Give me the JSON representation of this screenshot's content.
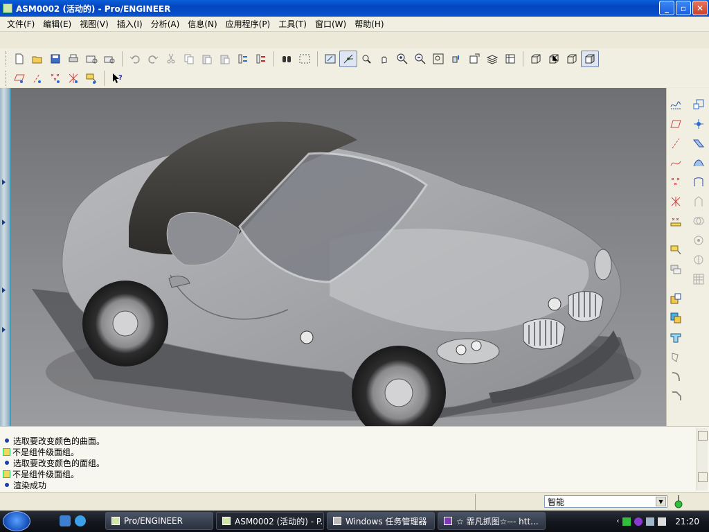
{
  "window": {
    "title": "ASM0002 (活动的) - Pro/ENGINEER",
    "minimize": "_",
    "maximize": "▫",
    "close": "✕"
  },
  "menu": [
    {
      "label": "文件(F)"
    },
    {
      "label": "编辑(E)"
    },
    {
      "label": "视图(V)"
    },
    {
      "label": "插入(I)"
    },
    {
      "label": "分析(A)"
    },
    {
      "label": "信息(N)"
    },
    {
      "label": "应用程序(P)"
    },
    {
      "label": "工具(T)"
    },
    {
      "label": "窗口(W)"
    },
    {
      "label": "帮助(H)"
    }
  ],
  "toolbar1_icons": [
    "new-icon",
    "open-icon",
    "save-icon",
    "print-icon",
    "email-icon",
    "email-attach-icon",
    "undo-icon",
    "redo-icon",
    "cut-icon",
    "copy-icon",
    "paste-icon",
    "paste-special-icon",
    "regenerate-icon",
    "regen-manager-icon",
    "find-icon",
    "select-box-icon",
    "repaint-icon",
    "spin-center-icon",
    "orient-mode-icon",
    "pan-icon",
    "zoom-in-icon",
    "zoom-out-icon",
    "refit-icon",
    "reorient-icon",
    "saved-views-icon",
    "layers-icon",
    "view-manager-icon",
    "wireframe-icon",
    "hidden-line-icon",
    "no-hidden-icon",
    "shading-icon"
  ],
  "toolbar2_icons": [
    "datum-plane-icon",
    "datum-axis-icon",
    "datum-point-icon",
    "coord-sys-icon",
    "annotation-icon",
    "context-help-icon"
  ],
  "right_tools": [
    "sketch-curve-icon",
    "datum-plane-icon",
    "datum-axis-icon",
    "curve-icon",
    "datum-point-icon",
    "point-offset-icon",
    "coord-sys-icon",
    "annotation-icon",
    "layer-icon",
    "assemble-icon",
    "create-component-icon",
    "pattern-icon",
    "surface-icon",
    "trim-icon",
    "blend-icon",
    "merge-icon",
    "intersect-icon",
    "copy-geom-icon",
    "extend-icon",
    "offset-icon",
    "thicken-icon",
    "solidify-icon",
    "round-icon",
    "chamfer-icon"
  ],
  "messages": [
    {
      "type": "info",
      "text": "选取要改变颜色的曲面。"
    },
    {
      "type": "warn",
      "text": "不是组件级面组。"
    },
    {
      "type": "info",
      "text": "选取要改变颜色的面组。"
    },
    {
      "type": "warn",
      "text": "不是组件级面组。"
    },
    {
      "type": "info",
      "text": "渲染成功"
    }
  ],
  "status": {
    "filter_value": "智能"
  },
  "taskbar": {
    "items": [
      {
        "label": "Pro/ENGINEER",
        "active": false
      },
      {
        "label": "ASM0002 (活动的) - P...",
        "active": true
      },
      {
        "label": "Windows 任务管理器",
        "active": false
      },
      {
        "label": "☆ 霏凡抓图☆--- htt...",
        "active": false
      }
    ],
    "clock": "21:20"
  },
  "colors": {
    "titlebar": "#0346c0",
    "accent": "#33a0c4",
    "viewport_bg": "#8a8b8e",
    "car_body": "#a4a5a8",
    "soft_top": "#3a3936"
  }
}
